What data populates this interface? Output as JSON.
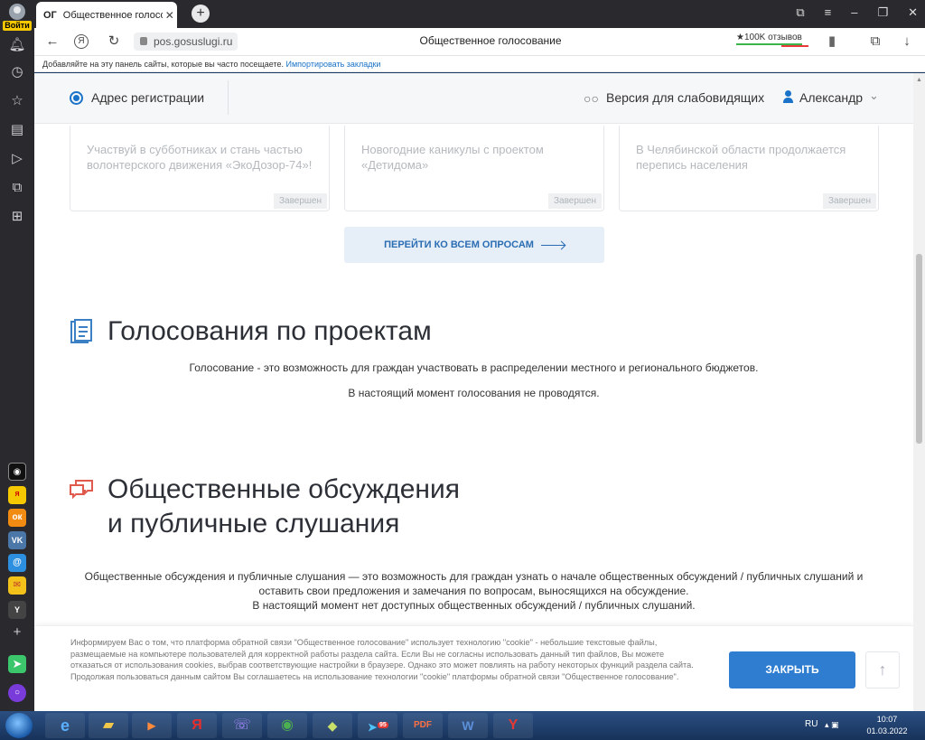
{
  "browser": {
    "login_label": "Войти",
    "tab": {
      "badge": "ОГ",
      "title": "Общественное голосо",
      "close": "✕"
    },
    "new_tab": "+",
    "url": "pos.gosuslugi.ru",
    "page_title": "Общественное голосование",
    "reviews": "★100K отзывов",
    "bookmarks_prompt": "Добавляйте на эту панель сайты, которые вы часто посещаете.",
    "bookmarks_import": "Импортировать закладки"
  },
  "header": {
    "address_label": "Адрес регистрации",
    "vision_label": "Версия для слабовидящих",
    "user_name": "Александр"
  },
  "cards": [
    {
      "text": "Участвуй в субботниках и стань частью волонтерского движения «ЭкоДозор-74»!",
      "status": "Завершен"
    },
    {
      "text": "Новогодние каникулы с проектом «Детидома»",
      "status": "Завершен"
    },
    {
      "text": "В Челябинской области продолжается перепись населения",
      "status": "Завершен"
    }
  ],
  "all_polls_button": "ПЕРЕЙТИ КО ВСЕМ ОПРОСАМ",
  "voting": {
    "title": "Голосования по проектам",
    "description": "Голосование - это возможность для граждан участвовать в распределении местного и регионального бюджетов.",
    "status": "В настоящий момент голосования не проводятся."
  },
  "discussions": {
    "title_line1": "Общественные обсуждения",
    "title_line2": "и публичные слушания",
    "description": "Общественные обсуждения и публичные слушания — это возможность для граждан узнать о начале общественных обсуждений / публичных слушаний и оставить свои предложения и замечания по вопросам, выносящихся на обсуждение.",
    "status": "В настоящий момент нет доступных общественных обсуждений / публичных слушаний."
  },
  "cookie": {
    "text": "Информируем Вас о том, что платформа обратной связи \"Общественное голосование\" использует технологию \"cookie\" - небольшие текстовые файлы, размещаемые на компьютере пользователей для корректной работы раздела сайта. Если Вы не согласны использовать данный тип файлов, Вы можете отказаться от использования cookies, выбрав соответствующие настройки в браузере. Однако это может повлиять на работу некоторых функций раздела сайта. Продолжая пользоваться данным сайтом Вы соглашаетесь на использование технологии \"cookie\" платформы обратной связи \"Общественное голосование\".",
    "close_button": "ЗАКРЫТЬ"
  },
  "sidebar_apps": [
    "Y"
  ],
  "taskbar": {
    "yandex_label": "Я",
    "lang": "RU",
    "time": "10:07",
    "date": "01.03.2022",
    "telegram_badge": "95"
  },
  "colors": {
    "accent": "#2e7dd1",
    "link": "#1a73c8",
    "discussion_icon": "#e05a4e",
    "voting_icon": "#3b7fc4"
  }
}
